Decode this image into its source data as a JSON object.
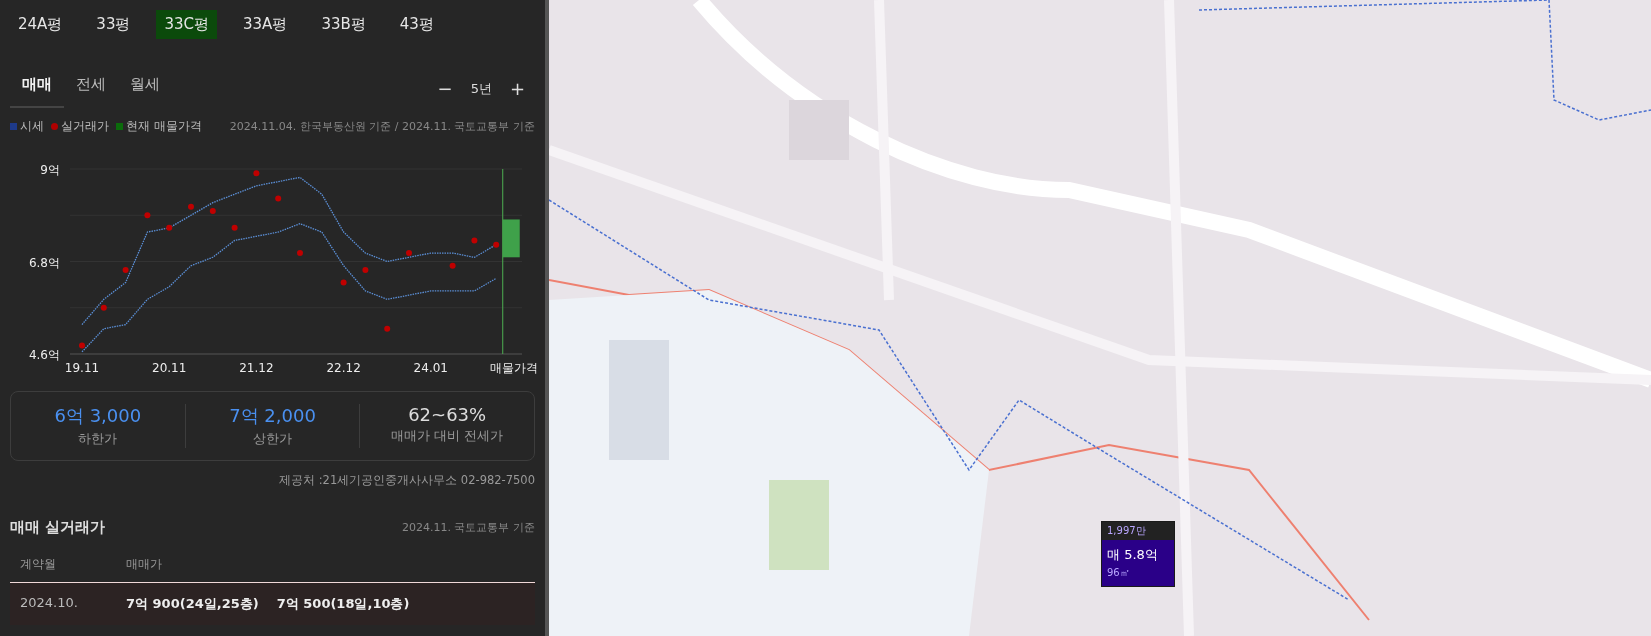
{
  "size_tabs": [
    {
      "label": "24A평",
      "selected": false
    },
    {
      "label": "33평",
      "selected": false
    },
    {
      "label": "33C평",
      "selected": true
    },
    {
      "label": "33A평",
      "selected": false
    },
    {
      "label": "33B평",
      "selected": false
    },
    {
      "label": "43평",
      "selected": false
    }
  ],
  "deal_tabs": [
    {
      "label": "매매",
      "selected": true
    },
    {
      "label": "전세",
      "selected": false
    },
    {
      "label": "월세",
      "selected": false
    }
  ],
  "period": {
    "minus": "−",
    "value": "5년",
    "plus": "+"
  },
  "legend": [
    {
      "kind": "square",
      "color": "#1e3a8a"
    },
    {
      "kind": "dot",
      "color": "#b00000"
    },
    {
      "kind": "square",
      "color": "#0b6b0b"
    }
  ],
  "source_note": "2024.11.04. 한국부동산원 기준 / 2024.11. 국토교통부 기준",
  "chart_data": {
    "type": "line",
    "categories": [
      "19.11",
      null,
      null,
      null,
      "20.11",
      null,
      null,
      null,
      "21.12",
      null,
      null,
      null,
      "22.12",
      null,
      null,
      null,
      "24.01",
      null,
      null,
      null,
      "매물가격"
    ],
    "series": [
      {
        "name": "시세",
        "color": "#5b8fd6",
        "line_style": "dotted",
        "values": [
          5.3,
          5.9,
          6.3,
          7.5,
          7.6,
          7.9,
          8.2,
          8.4,
          8.6,
          8.7,
          8.8,
          8.4,
          7.5,
          7.0,
          6.8,
          6.9,
          7.0,
          7.0,
          6.9,
          7.2,
          null
        ]
      },
      {
        "color": "#5b8fd6",
        "line_style": "dotted",
        "values": [
          4.65,
          5.2,
          5.3,
          5.9,
          6.2,
          6.7,
          6.9,
          7.3,
          7.4,
          7.5,
          7.7,
          7.5,
          6.7,
          6.1,
          5.9,
          6.0,
          6.1,
          6.1,
          6.1,
          6.4,
          null
        ]
      },
      {
        "name": "실거래가",
        "color": "#c00000",
        "type": "scatter",
        "values": [
          4.8,
          5.7,
          6.6,
          7.9,
          7.6,
          8.1,
          8.0,
          7.6,
          8.9,
          8.3,
          7.0,
          null,
          6.3,
          6.6,
          5.2,
          7.0,
          null,
          6.7,
          7.3,
          7.2,
          null
        ]
      },
      {
        "name": "현재 매물가격",
        "color": "#3fa14a",
        "type": "scatter",
        "values": [
          null,
          null,
          null,
          null,
          null,
          null,
          null,
          null,
          null,
          null,
          null,
          null,
          null,
          null,
          null,
          null,
          null,
          null,
          null,
          null,
          7.35
        ]
      }
    ],
    "ylim": [
      4.6,
      9
    ],
    "yticks": [
      {
        "value": 4.6,
        "label": "4.6억"
      },
      {
        "value": 6.8,
        "label": "6.8억"
      },
      {
        "value": 9,
        "label": "9억"
      }
    ]
  },
  "summary": [
    {
      "value": "6억 3,000",
      "label": "하한가",
      "highlight": true
    },
    {
      "value": "7억 2,000",
      "label": "상한가",
      "highlight": true
    },
    {
      "value": "62~63%",
      "label": "매매가 대비 전세가",
      "highlight": false
    }
  ],
  "provider": "제공처 :21세기공인중개사사무소 02-982-7500",
  "deals": {
    "title": "매매 실거래가",
    "note": "2024.11. 국토교통부 기준",
    "columns": [
      "계약월",
      "매매가"
    ],
    "rows": [
      {
        "month": "2024.10.",
        "prices": [
          "7억 900(24일,25층)",
          "7억 500(18일,10층)"
        ]
      }
    ]
  },
  "map_marker": {
    "unit_price": "1,997만",
    "price": "매 5.8억",
    "area": "96㎡"
  }
}
